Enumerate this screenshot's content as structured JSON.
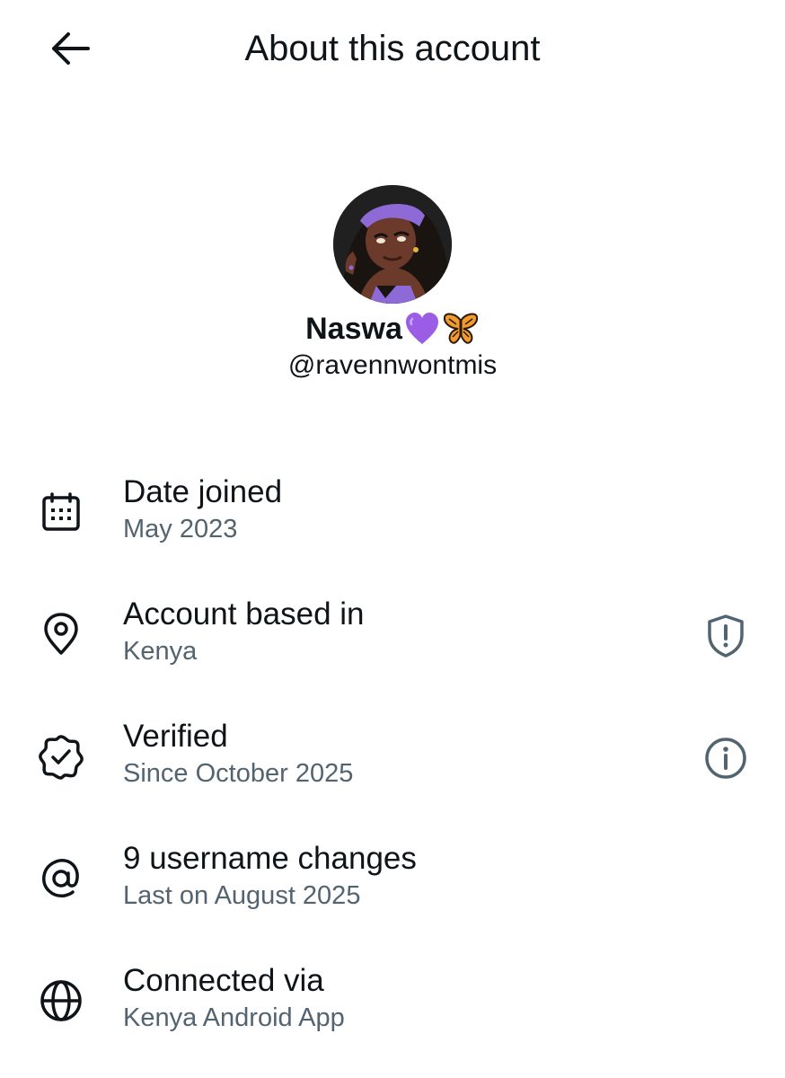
{
  "header": {
    "title": "About this account",
    "back_icon": "arrow-left-icon"
  },
  "profile": {
    "display_name": "Naswa",
    "name_emojis": [
      "purple-heart-icon",
      "butterfly-icon"
    ],
    "handle": "@ravennwontmis"
  },
  "rows": [
    {
      "label": "Date joined",
      "value": "May 2023",
      "icon": "calendar-icon"
    },
    {
      "label": "Account based in",
      "value": "Kenya",
      "icon": "location-pin-icon",
      "action_icon": "shield-alert-icon"
    },
    {
      "label": "Verified",
      "value": "Since October 2025",
      "icon": "verified-badge-icon",
      "action_icon": "info-icon"
    },
    {
      "label": "9 username changes",
      "value": "Last on August 2025",
      "icon": "at-sign-icon"
    },
    {
      "label": "Connected via",
      "value": "Kenya Android App",
      "icon": "globe-icon"
    }
  ],
  "colors": {
    "primary_text": "#0f1419",
    "secondary_text": "#536471",
    "background": "#ffffff"
  }
}
